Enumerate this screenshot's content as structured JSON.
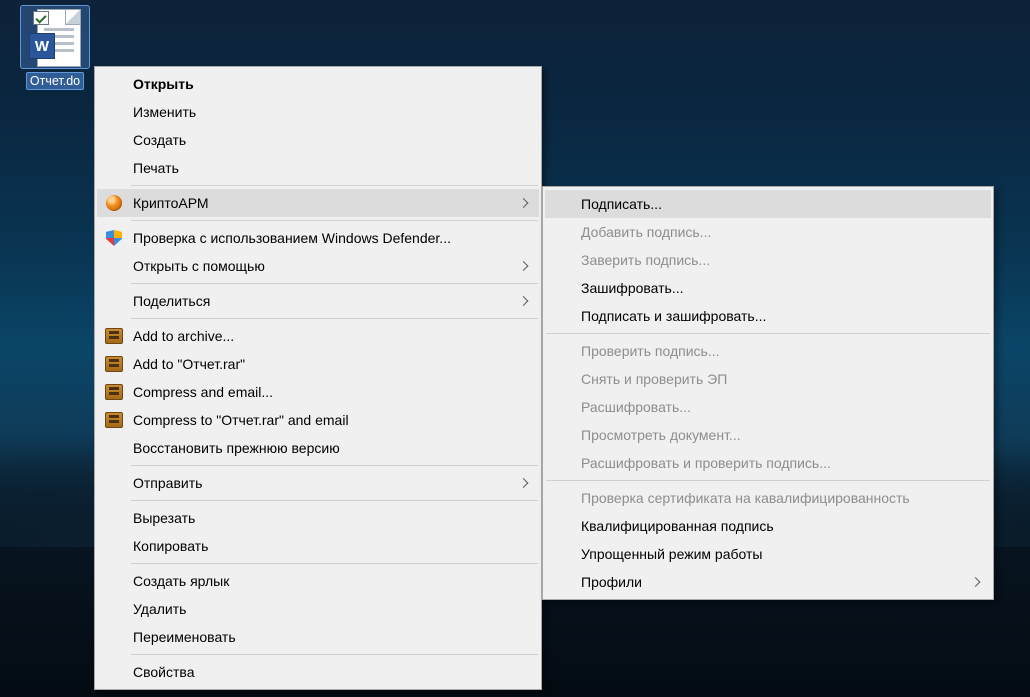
{
  "desktop": {
    "file_label": "Отчет.do"
  },
  "context": {
    "open": "Открыть",
    "edit": "Изменить",
    "create": "Создать",
    "print": "Печать",
    "cryptoarm": "КриптоАРМ",
    "defender": "Проверка с использованием Windows Defender...",
    "open_with": "Открыть с помощью",
    "share": "Поделиться",
    "add_archive": "Add to archive...",
    "add_rar": "Add to \"Отчет.rar\"",
    "compress_email": "Compress and email...",
    "compress_rar_email": "Compress to \"Отчет.rar\" and email",
    "restore_prev": "Восстановить прежнюю версию",
    "send_to": "Отправить",
    "cut": "Вырезать",
    "copy": "Копировать",
    "shortcut": "Создать ярлык",
    "delete": "Удалить",
    "rename": "Переименовать",
    "properties": "Свойства"
  },
  "sub": {
    "sign": "Подписать...",
    "add_sign": "Добавить подпись...",
    "verify_sign": "Заверить подпись...",
    "encrypt": "Зашифровать...",
    "sign_encrypt": "Подписать и зашифровать...",
    "check_sign": "Проверить подпись...",
    "remove_check": "Снять и проверить ЭП",
    "decrypt": "Расшифровать...",
    "view_doc": "Просмотреть документ...",
    "decrypt_check": "Расшифровать и проверить подпись...",
    "cert_check": "Проверка сертификата на кавалифицированность",
    "qualified": "Квалифицированная подпись",
    "simple_mode": "Упрощенный режим работы",
    "profiles": "Профили"
  }
}
